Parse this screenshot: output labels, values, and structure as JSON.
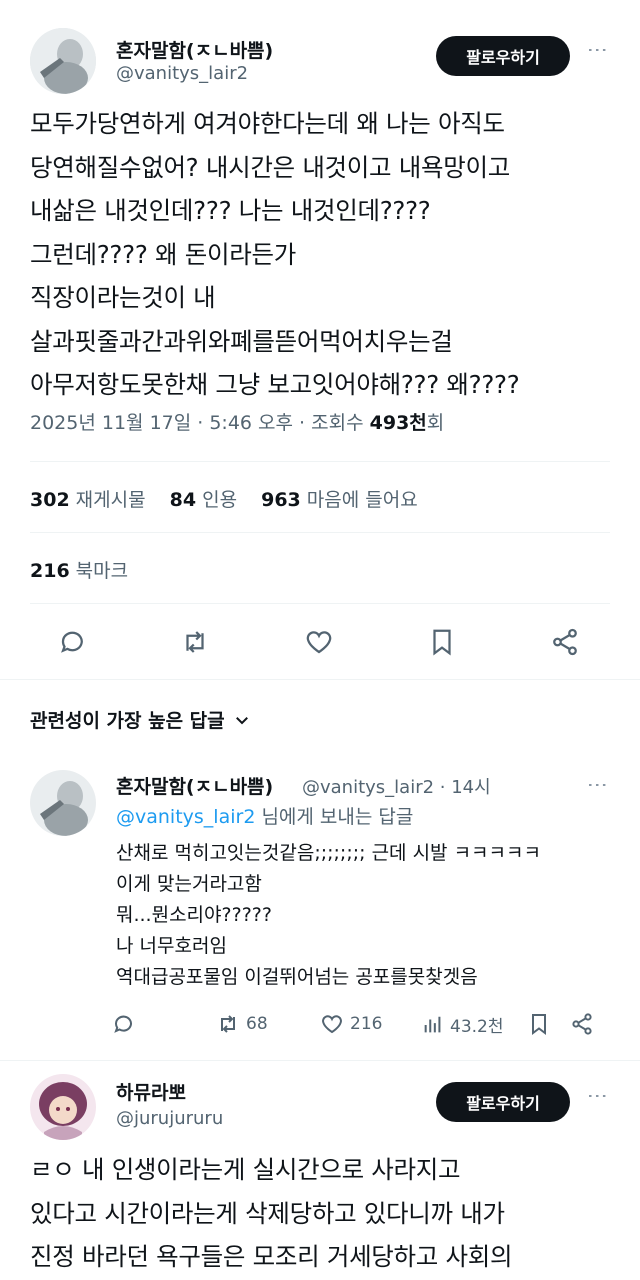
{
  "tweet": {
    "author_name": "혼자말함(ㅈㄴ바쁨)",
    "author_handle": "@vanitys_lair2",
    "follow_label": "팔로우하기",
    "lines": [
      "모두가당연하게 여겨야한다는데 왜 나는 아직도",
      "당연해질수없어? 내시간은 내것이고 내욕망이고",
      "내삶은 내것인데??? 나는 내것인데????",
      "그런데???? 왜 돈이라든가",
      "직장이라는것이 내",
      "살과핏줄과간과위와폐를뜯어먹어치우는걸",
      "아무저항도못한채 그냥 보고잇어야해??? 왜????"
    ],
    "date": "2025년 11월 17일 · 5:46 오후 · 조회수 ",
    "views": "493천",
    "views_suffix": "회",
    "reposts": "302",
    "reposts_label": "재게시물",
    "quotes": "84",
    "quotes_label": "인용",
    "likes": "963",
    "likes_label": "마음에 들어요",
    "bookmarks": "216",
    "bookmarks_label": "북마크"
  },
  "sort_label": "관련성이 가장 높은 답글",
  "reply1": {
    "author_name": "혼자말함(ㅈㄴ바쁨)",
    "handle_time": "@vanitys_lair2 · 14시",
    "reply_to_handle": "@vanitys_lair2",
    "reply_to_suffix": " 님에게 보내는 답글",
    "lines": [
      "산채로 먹히고잇는것같음;;;;;;;; 근데 시발 ㅋㅋㅋㅋㅋ",
      "이게 맞는거라고함",
      "뭐...뭔소리야?????",
      "나 너무호러임",
      "역대급공포물임 이걸뛰어넘는 공포를못찾겟음"
    ],
    "reposts": "68",
    "likes": "216",
    "views": "43.2천"
  },
  "reply2": {
    "author_name": "하뮤라뽀",
    "author_handle": "@jurujururu",
    "follow_label": "팔로우하기",
    "lines": [
      "ㄹㅇ 내 인생이라는게 실시간으로 사라지고",
      "있다고 시간이라는게 삭제당하고 있다니까 내가",
      "진정 바라던 욕구들은 모조리 거세당하고 사회의"
    ]
  }
}
